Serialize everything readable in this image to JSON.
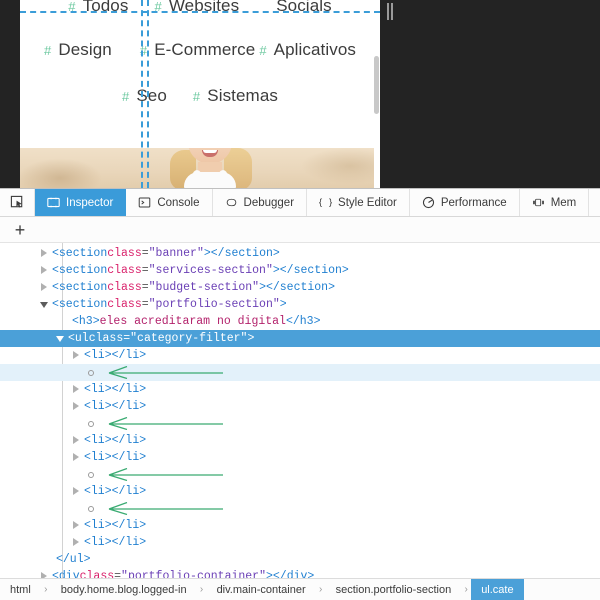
{
  "page": {
    "categories_rows": [
      [
        {
          "hash": "#",
          "label": "Todos"
        },
        {
          "hash": "#",
          "label": "Websites"
        },
        {
          "hash": "",
          "label": "Socials"
        }
      ],
      [
        {
          "hash": "#",
          "label": "Design"
        },
        {
          "hash": "#",
          "label": "E-Commerce"
        },
        {
          "hash": "#",
          "label": "Aplicativos"
        }
      ],
      [
        {
          "hash": "#",
          "label": "Seo"
        },
        {
          "hash": "#",
          "label": "Sistemas"
        }
      ]
    ],
    "overlay_color": "#3b9dd8",
    "hash_color": "#6dc9a0"
  },
  "devtools": {
    "accent": "#4ba0d8",
    "picker_icon": "element-picker-icon",
    "add_tab_label": "+",
    "tabs": [
      {
        "label": "Inspector",
        "icon": "inspector-icon",
        "active": true
      },
      {
        "label": "Console",
        "icon": "console-icon",
        "active": false
      },
      {
        "label": "Debugger",
        "icon": "debugger-icon",
        "active": false
      },
      {
        "label": "Style Editor",
        "icon": "style-editor-icon",
        "active": false
      },
      {
        "label": "Performance",
        "icon": "performance-icon",
        "active": false
      },
      {
        "label": "Mem",
        "icon": "memory-icon",
        "active": false
      }
    ],
    "dom_nodes": [
      {
        "kind": "element",
        "indent": 40,
        "twisty": "closed",
        "state": "normal",
        "open_lt": "<",
        "tag": "section",
        "attr": "class",
        "eq": "=",
        "val": "\"banner\"",
        "open_gt": ">",
        "close": "</section>"
      },
      {
        "kind": "element",
        "indent": 40,
        "twisty": "closed",
        "state": "normal",
        "open_lt": "<",
        "tag": "section",
        "attr": "class",
        "eq": "=",
        "val": "\"services-section\"",
        "open_gt": ">",
        "close": "</section>"
      },
      {
        "kind": "element",
        "indent": 40,
        "twisty": "closed",
        "state": "normal",
        "open_lt": "<",
        "tag": "section",
        "attr": "class",
        "eq": "=",
        "val": "\"budget-section\"",
        "open_gt": ">",
        "close": "</section>"
      },
      {
        "kind": "element",
        "indent": 40,
        "twisty": "open",
        "state": "normal",
        "open_lt": "<",
        "tag": "section",
        "attr": "class",
        "eq": "=",
        "val": "\"portfolio-section\"",
        "open_gt": ">",
        "close": ""
      },
      {
        "kind": "text",
        "indent": 72,
        "state": "normal",
        "open_lt": "<",
        "tag": "h3",
        "open_gt": ">",
        "text": "eles acreditaram no digital",
        "close": "</h3>"
      },
      {
        "kind": "element",
        "indent": 56,
        "twisty": "open",
        "state": "selected",
        "open_lt": "<",
        "tag": "ul",
        "attr": "class",
        "eq": "=",
        "val": "\"category-filter\"",
        "open_gt": ">",
        "close": ""
      },
      {
        "kind": "element",
        "indent": 72,
        "twisty": "closed",
        "state": "normal",
        "open_lt": "<",
        "tag": "li",
        "open_gt": ">",
        "close": "</li>"
      },
      {
        "kind": "whitespace",
        "indent": 88,
        "state": "hover",
        "arrow": true
      },
      {
        "kind": "element",
        "indent": 72,
        "twisty": "closed",
        "state": "normal",
        "open_lt": "<",
        "tag": "li",
        "open_gt": ">",
        "close": "</li>"
      },
      {
        "kind": "element",
        "indent": 72,
        "twisty": "closed",
        "state": "normal",
        "open_lt": "<",
        "tag": "li",
        "open_gt": ">",
        "close": "</li>"
      },
      {
        "kind": "whitespace",
        "indent": 88,
        "state": "normal",
        "arrow": true
      },
      {
        "kind": "element",
        "indent": 72,
        "twisty": "closed",
        "state": "normal",
        "open_lt": "<",
        "tag": "li",
        "open_gt": ">",
        "close": "</li>"
      },
      {
        "kind": "element",
        "indent": 72,
        "twisty": "closed",
        "state": "normal",
        "open_lt": "<",
        "tag": "li",
        "open_gt": ">",
        "close": "</li>"
      },
      {
        "kind": "whitespace",
        "indent": 88,
        "state": "normal",
        "arrow": true
      },
      {
        "kind": "element",
        "indent": 72,
        "twisty": "closed",
        "state": "normal",
        "open_lt": "<",
        "tag": "li",
        "open_gt": ">",
        "close": "</li>"
      },
      {
        "kind": "whitespace",
        "indent": 88,
        "state": "normal",
        "arrow": true
      },
      {
        "kind": "element",
        "indent": 72,
        "twisty": "closed",
        "state": "normal",
        "open_lt": "<",
        "tag": "li",
        "open_gt": ">",
        "close": "</li>"
      },
      {
        "kind": "element",
        "indent": 72,
        "twisty": "closed",
        "state": "normal",
        "open_lt": "<",
        "tag": "li",
        "open_gt": ">",
        "close": "</li>"
      },
      {
        "kind": "closetag",
        "indent": 56,
        "state": "normal",
        "close": "</ul>"
      },
      {
        "kind": "element",
        "indent": 40,
        "twisty": "closed",
        "state": "normal",
        "open_lt": "<",
        "tag": "div",
        "attr": "class",
        "eq": "=",
        "val": "\"portfolio-container\"",
        "open_gt": ">",
        "close": "</div>"
      }
    ],
    "breadcrumb": [
      {
        "label": "html",
        "active": false
      },
      {
        "label": "body.home.blog.logged-in",
        "active": false
      },
      {
        "label": "div.main-container",
        "active": false
      },
      {
        "label": "section.portfolio-section",
        "active": false
      },
      {
        "label": "ul.cate",
        "active": true
      }
    ],
    "breadcrumb_separator": "›"
  }
}
